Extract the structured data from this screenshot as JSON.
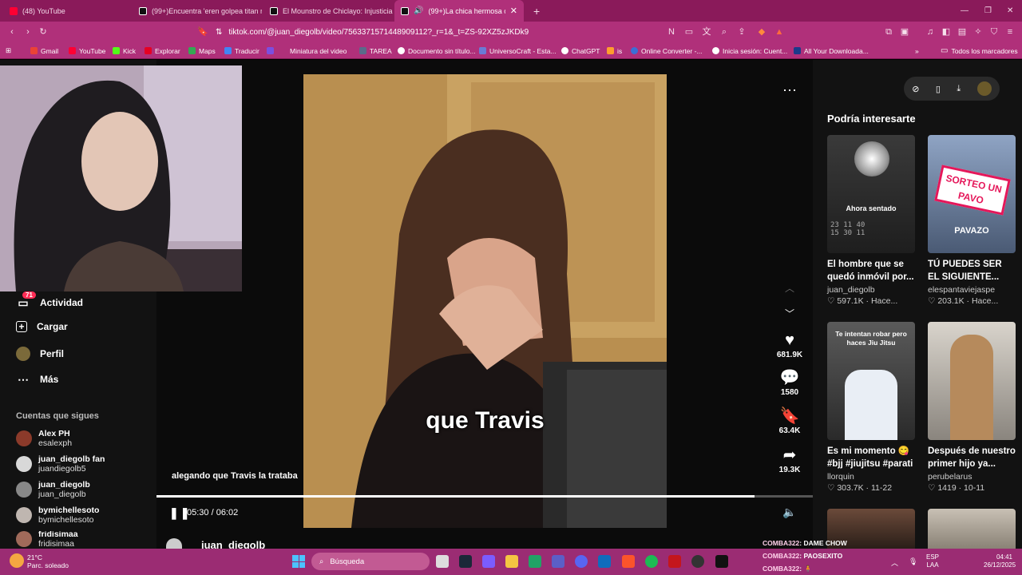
{
  "tabs": [
    {
      "label": "(48) YouTube",
      "color": "#ff0033"
    },
    {
      "label": "(99+)Encuentra 'eren golpea titan m",
      "color": "#111111"
    },
    {
      "label": "El Mounstro de Chiclayo: Injusticia en",
      "color": "#111111"
    },
    {
      "label": "(99+)La chica hermosa con u",
      "color": "#111111",
      "active": true
    }
  ],
  "window_controls": [
    "—",
    "❐",
    "✕"
  ],
  "address": "tiktok.com/@juan_diegolb/video/7563371571448909112?_r=1&_t=ZS-92XZ5zJKDk9",
  "bookmarks": [
    "Gmail",
    "YouTube",
    "Kick",
    "Explorar",
    "Maps",
    "Traducir",
    "Miniatura del video",
    "TAREA",
    "Documento sin título...",
    "UniversoCraft - Esta...",
    "ChatGPT",
    "is",
    "Online Converter -...",
    "Inicia sesión: Cuent...",
    "All Your Downloada..."
  ],
  "bookmarks_folder": "Todos los marcadores",
  "sidebar": {
    "items": [
      {
        "label": "Actividad",
        "badge": "71"
      },
      {
        "label": "Cargar"
      },
      {
        "label": "Perfil"
      },
      {
        "label": "Más"
      }
    ],
    "following_title": "Cuentas que sigues",
    "following": [
      {
        "name": "Alex PH",
        "handle": "esalexph"
      },
      {
        "name": "juan_diegolb fan",
        "handle": "juandiegolb5"
      },
      {
        "name": "juan_diegolb",
        "handle": "juan_diegolb"
      },
      {
        "name": "bymichellesoto",
        "handle": "bymichellesoto"
      },
      {
        "name": "fridisimaa",
        "handle": "fridisimaa"
      }
    ]
  },
  "video": {
    "subtitle": "que Travis",
    "caption": "alegando que Travis la trataba",
    "time": "05:30 / 06:02",
    "progress": 0.911,
    "author": "juan_diegolb",
    "likes": "681.9K",
    "comments": "1580",
    "saves": "63.4K",
    "shares": "19.3K"
  },
  "recommend": {
    "title": "Podría interesarte",
    "cards": [
      {
        "title": "El hombre que se quedó inmóvil por...",
        "user": "juan_diegolb",
        "likes": "597.1K",
        "date": "Hace...",
        "overlay": "Ahora sentado",
        "stamp": "23 11 40\n15 30 11"
      },
      {
        "title": "TÚ PUEDES SER EL SIGUIENTE...",
        "user": "elespantaviejaspe",
        "likes": "203.1K",
        "date": "Hace...",
        "overlay": "SORTEO UN PAVO",
        "overlay2": "PAVAZO"
      },
      {
        "title": "Es mi momento 😋 #bjj #jiujitsu #parati",
        "user": "llorquin",
        "likes": "303.7K",
        "date": "11-22",
        "overlay": "Te intentan robar pero haces Jiu Jitsu"
      },
      {
        "title": "Después de nuestro primer hijo ya...",
        "user": "perubelarus",
        "likes": "1419",
        "date": "10-11"
      }
    ]
  },
  "chat": [
    {
      "user": "COMBA322",
      "msg": ": DAME CHOW"
    },
    {
      "user": "COMBA322",
      "msg": ": PAOSEXITO"
    },
    {
      "user": "COMBA322",
      "msg": ": 🧍"
    }
  ],
  "taskbar": {
    "weather_temp": "21°C",
    "weather_desc": "Parc. soleado",
    "search": "Búsqueda",
    "lang1": "ESP",
    "lang2": "LAA",
    "time": "04:41",
    "date": "26/12/2025"
  }
}
